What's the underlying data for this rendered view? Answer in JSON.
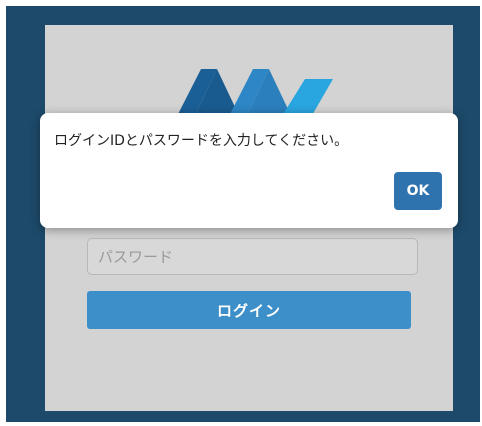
{
  "login_page": {
    "password_placeholder": "パスワード",
    "login_button_label": "ログイン",
    "logo_icon": "company-logo-icon"
  },
  "dialog": {
    "message": "ログインIDとパスワードを入力してください。",
    "ok_label": "OK"
  },
  "colors": {
    "background": "#1d4a6a",
    "panel": "#d3d3d3",
    "login_button": "#3d8fc9",
    "ok_button": "#2f73ae"
  }
}
